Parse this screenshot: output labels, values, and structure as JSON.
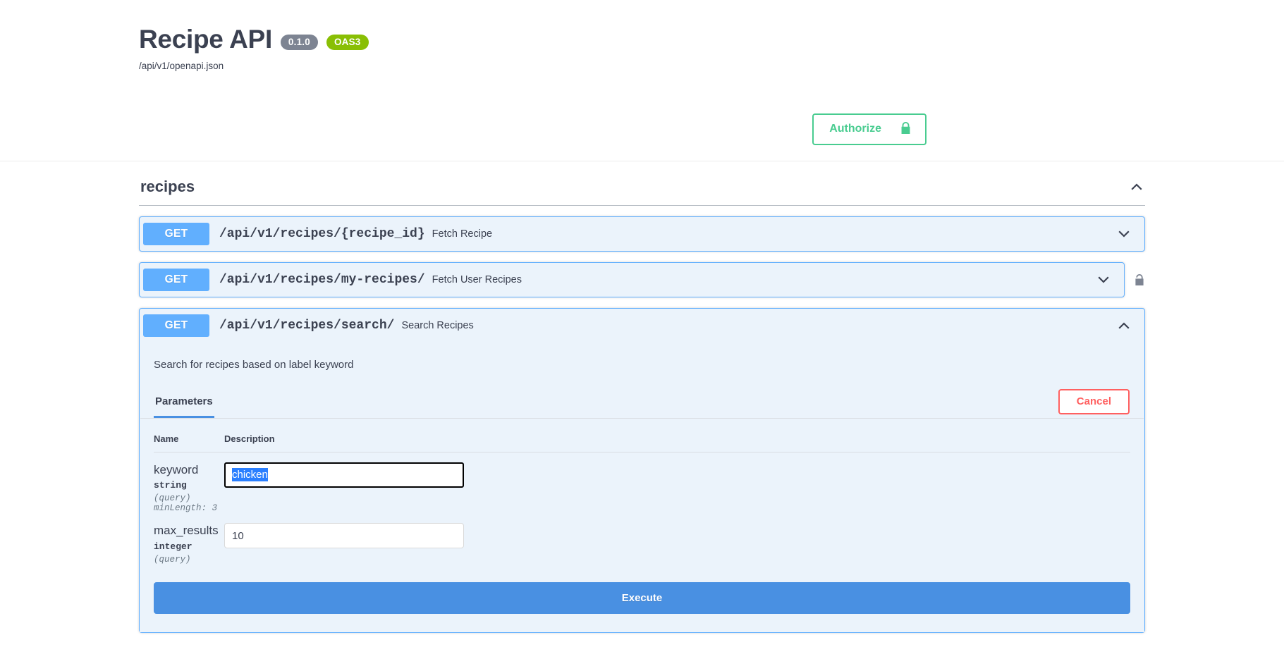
{
  "header": {
    "title": "Recipe API",
    "version_badge": "0.1.0",
    "spec_badge": "OAS3",
    "spec_url": "/api/v1/openapi.json",
    "authorize_label": "Authorize",
    "authorize_icon": "lock-closed-icon",
    "accent_green": "#49cc90"
  },
  "tag": {
    "name": "recipes",
    "collapse_icon": "chevron-up-icon"
  },
  "operations": [
    {
      "method": "GET",
      "path": "/api/v1/recipes/{recipe_id}",
      "summary": "Fetch Recipe",
      "expanded": false,
      "locked": false,
      "chevron": "chevron-down-icon"
    },
    {
      "method": "GET",
      "path": "/api/v1/recipes/my-recipes/",
      "summary": "Fetch User Recipes",
      "expanded": false,
      "locked": true,
      "lock_icon": "lock-open-icon",
      "chevron": "chevron-down-icon"
    },
    {
      "method": "GET",
      "path": "/api/v1/recipes/search/",
      "summary": "Search Recipes",
      "expanded": true,
      "locked": false,
      "chevron": "chevron-up-icon"
    }
  ],
  "expanded_op": {
    "description": "Search for recipes based on label keyword",
    "tab_label": "Parameters",
    "cancel_label": "Cancel",
    "execute_label": "Execute",
    "table_headers": {
      "name": "Name",
      "description": "Description"
    },
    "parameters": [
      {
        "name": "keyword",
        "type": "string",
        "in": "(query)",
        "constraint": "minLength: 3",
        "value": "chicken",
        "placeholder": "keyword",
        "focused": true,
        "text_selected": true
      },
      {
        "name": "max_results",
        "type": "integer",
        "in": "(query)",
        "constraint": "",
        "value": "10",
        "placeholder": "max_results",
        "focused": false,
        "text_selected": false
      }
    ]
  },
  "colors": {
    "method_blue": "#61affe",
    "execute_blue": "#4990e2",
    "cancel_red": "#ff6060",
    "badge_gray": "#7d8492",
    "badge_green": "#89bf04"
  }
}
